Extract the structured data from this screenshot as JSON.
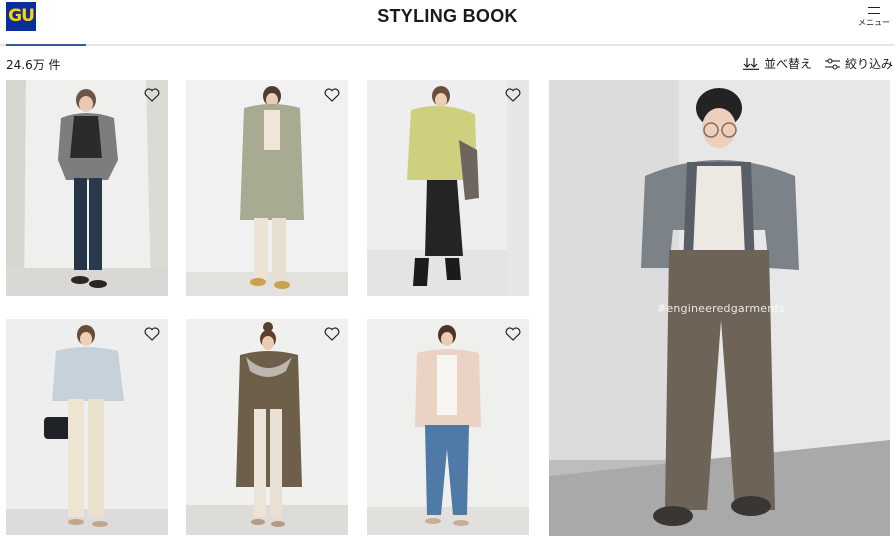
{
  "header": {
    "logo_text": "GU",
    "title": "STYLING BOOK",
    "menu_label": "メニュー"
  },
  "toolbar": {
    "result_count": "24.6万 件",
    "sort_label": "並べ替え",
    "filter_label": "絞り込み"
  },
  "feature": {
    "hashtag": "#engineeredgarments"
  },
  "colors": {
    "brand_blue": "#0a2f9c",
    "brand_yellow": "#ffd200",
    "tab_indicator": "#3b5a9a"
  },
  "icons": {
    "logo": "gu-logo",
    "menu": "hamburger-icon",
    "sort": "sort-icon",
    "filter": "filter-icon",
    "favorite": "heart-icon"
  }
}
